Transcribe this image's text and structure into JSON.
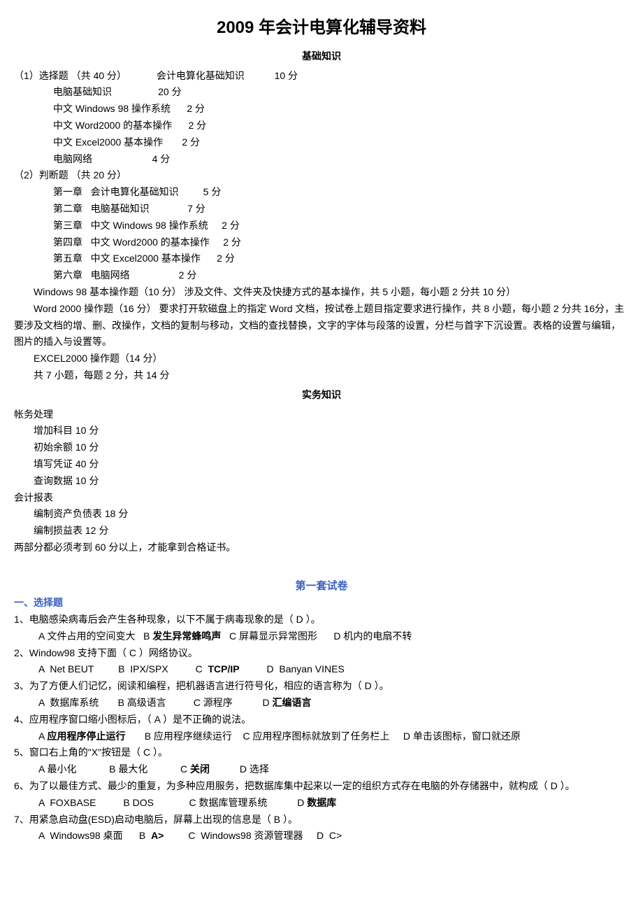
{
  "title": "2009 年会计电算化辅导资料",
  "section1_title": "基础知识",
  "syllabus": {
    "mc_header": "（1）选择题 （共 40 分）           会计电算化基础知识           10 分",
    "mc_items": [
      "电脑基础知识                 20 分",
      "中文 Windows 98 操作系统      2 分",
      "中文 Word2000 的基本操作      2 分",
      "中文 Excel2000 基本操作       2 分",
      "电脑网络                      4 分"
    ],
    "tf_header": "（2）判断题 （共 20 分）",
    "tf_items": [
      "第一章   会计电算化基础知识         5 分",
      "第二章   电脑基础知识              7 分",
      "第三章   中文 Windows 98 操作系统     2 分",
      "第四章   中文 Word2000 的基本操作     2 分",
      "第五章   中文 Excel2000 基本操作      2 分",
      "第六章   电脑网络                  2 分"
    ],
    "para1": "Windows 98 基本操作题（10 分）    涉及文件、文件夹及快捷方式的基本操作，共 5 小题，每小题 2 分共 10 分）",
    "para2": "Word 2000 操作题（16 分）    要求打开软磁盘上的指定 Word 文档，按试卷上题目指定要求进行操作，共 8 小题，每小题 2 分共 16分，主要涉及文档的增、删、改操作，文档的复制与移动，文档的查找替换，文字的字体与段落的设置，分栏与首字下沉设置。表格的设置与编辑，图片的插入与设置等。",
    "para3": "EXCEL2000 操作题（14 分）",
    "para4": "共 7 小题，每题 2 分，共 14 分"
  },
  "section2_title": "实务知识",
  "practical": {
    "h1": "帐务处理",
    "p1": [
      "增加科目 10 分",
      "初始余额 10 分",
      "填写凭证 40 分",
      "查询数据 10 分"
    ],
    "h2": "会计报表",
    "p2": [
      "编制资产负债表 18 分",
      "编制损益表 12 分"
    ],
    "note": "两部分都必须考到 60 分以上，才能拿到合格证书。"
  },
  "test_title": "第一套试卷",
  "q_header": "一、选择题",
  "questions": [
    {
      "q": "1、电脑感染病毒后会产生各种现象，以下不属于病毒现象的是（  D  ）。",
      "opts": [
        {
          "pre": "A 文件占用的空间变大   B ",
          "bold": "发生异常蜂鸣声",
          "post": "   C 屏幕显示异常图形      D 机内的电扇不转"
        }
      ]
    },
    {
      "q": "2、Window98 支持下面（   C   ）网络协议。",
      "opts": [
        {
          "pre": "A  Net BEUT         B  IPX/SPX          C  ",
          "bold": "TCP/IP",
          "post": "          D  Banyan VINES"
        }
      ]
    },
    {
      "q": "3、为了方便人们记忆，阅读和编程，把机器语言进行符号化，相应的语言称为（  D  ）。",
      "opts": [
        {
          "pre": "A  数据库系统       B 高级语言          C 源程序           D ",
          "bold": "汇编语言",
          "post": ""
        }
      ]
    },
    {
      "q": "4、应用程序窗口缩小图标后，（ A ）是不正确的说法。",
      "opts": [
        {
          "pre": "A ",
          "bold": "应用程序停止运行",
          "post": "       B 应用程序继续运行    C 应用程序图标就放到了任务栏上     D 单击该图标，窗口就还原"
        }
      ]
    },
    {
      "q": "5、窗口右上角的\"X\"按钮是（  C  ）。",
      "opts": [
        {
          "pre": "A 最小化            B 最大化            C ",
          "bold": "关闭",
          "post": "           D 选择"
        }
      ]
    },
    {
      "q": "6、为了以最佳方式、最少的重复，为多种应用服务，把数据库集中起来以一定的组织方式存在电脑的外存储器中，就构成（  D  ）。",
      "opts": [
        {
          "pre": "A  FOXBASE          B DOS             C 数据库管理系统           D ",
          "bold": "数据库",
          "post": ""
        }
      ]
    },
    {
      "q": "7、用紧急启动盘(ESD)启动电脑后，屏幕上出现的信息是（  B  ）。",
      "opts": [
        {
          "pre": "A  Windows98 桌面      B  ",
          "bold": "A>",
          "post": "         C  Windows98 资源管理器     D  C>"
        }
      ]
    }
  ]
}
